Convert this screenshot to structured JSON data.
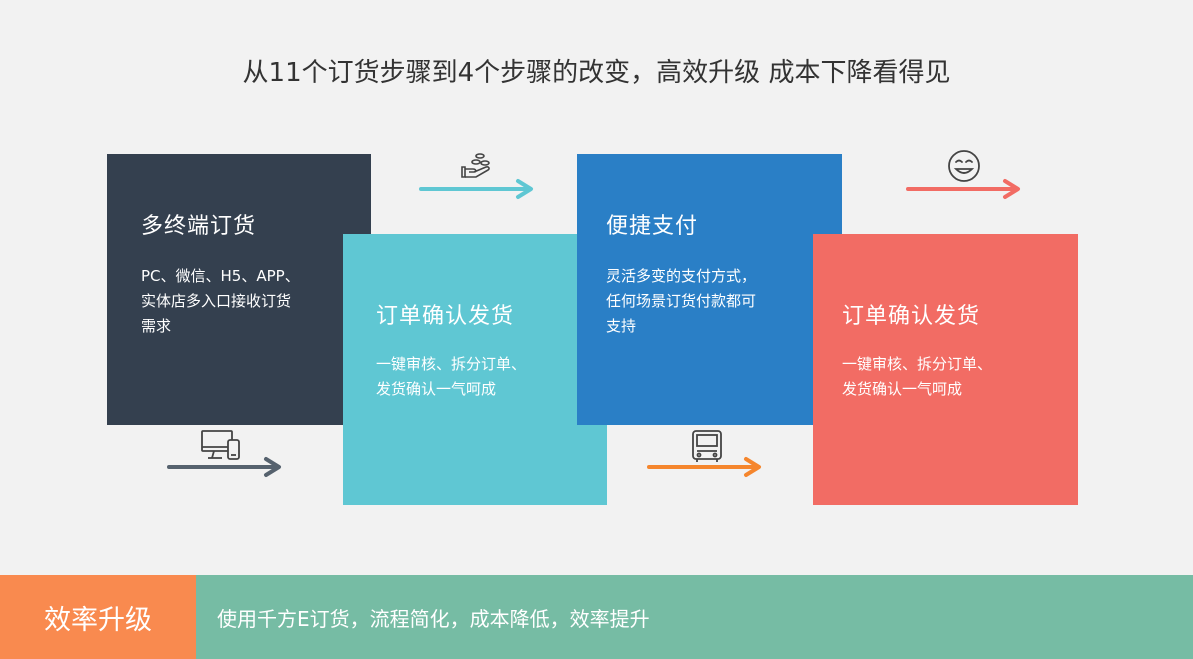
{
  "title": "从11个订货步骤到4个步骤的改变，高效升级 成本下降看得见",
  "cards": [
    {
      "title": "多终端订货",
      "desc": "PC、微信、H5、APP、\n实体店多入口接收订货\n需求"
    },
    {
      "title": "订单确认发货",
      "desc": "一键审核、拆分订单、\n发货确认一气呵成"
    },
    {
      "title": "便捷支付",
      "desc": "灵活多变的支付方式，\n任何场景订货付款都可\n支持"
    },
    {
      "title": "订单确认发货",
      "desc": "一键审核、拆分订单、\n发货确认一气呵成"
    }
  ],
  "icons": [
    "coins-hand-icon",
    "computer-phone-icon",
    "delivery-truck-icon",
    "smiley-face-icon"
  ],
  "colors": {
    "card1": "#34404f",
    "card2": "#5fc7d3",
    "card3": "#2a7fc6",
    "card4": "#f26c64",
    "arrow_teal": "#5fc7d3",
    "arrow_slate": "#56626e",
    "arrow_orange": "#f5862d",
    "arrow_coral": "#f26c64",
    "band_orange": "#f98a4f",
    "band_green": "#76bca4"
  },
  "bottom": {
    "label": "效率升级",
    "text": "使用千方E订货，流程简化，成本降低，效率提升"
  }
}
